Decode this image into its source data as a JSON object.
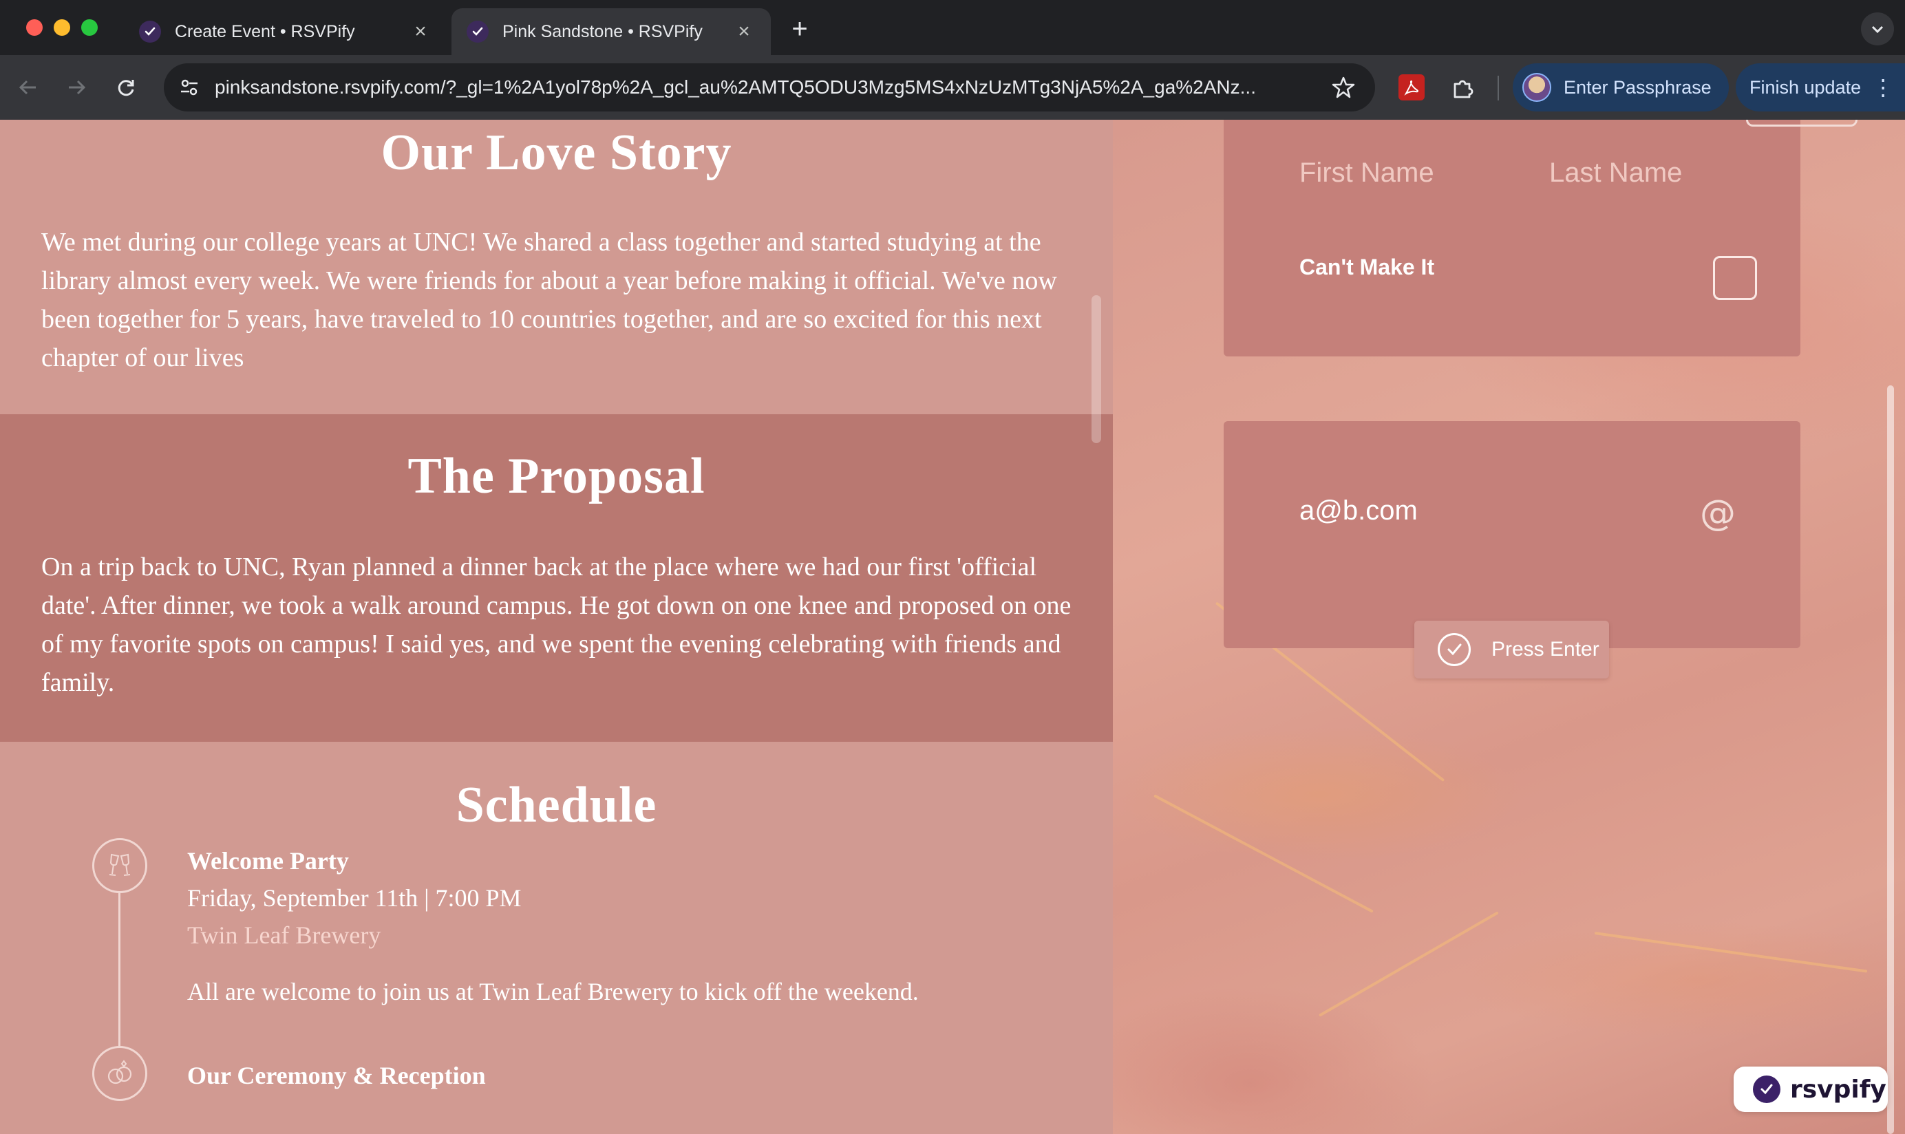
{
  "browser": {
    "tabs": [
      {
        "title": "Create Event • RSVPify",
        "active": false
      },
      {
        "title": "Pink Sandstone • RSVPify",
        "active": true
      }
    ],
    "url": "pinksandstone.rsvpify.com/?_gl=1%2A1yol78p%2A_gcl_au%2AMTQ5ODU3Mzg5MS4xNzUzMTg3NjA5%2A_ga%2ANz...",
    "profile_label": "Enter Passphrase",
    "update_label": "Finish update"
  },
  "love_story": {
    "title": "Our Love Story",
    "body": "We met during our college years at UNC! We shared a class together and started studying at the library almost every week. We were friends for about a year before making it official. We've now been together for 5 years, have traveled to 10 countries together, and are so excited for this next chapter of our lives"
  },
  "proposal": {
    "title": "The Proposal",
    "body": "On a trip back to UNC, Ryan planned a dinner back at the place where we had our first 'official date'. After dinner, we took a walk around campus. He got down on one knee and proposed on one of my favorite spots on campus! I said yes, and we spent the evening celebrating with friends and family."
  },
  "schedule": {
    "title": "Schedule",
    "events": [
      {
        "name": "Welcome Party",
        "when": "Friday, September 11th  |  7:00 PM",
        "venue": "Twin Leaf Brewery",
        "description": "All are welcome to join us at Twin Leaf Brewery to kick off the weekend.",
        "icon": "champagne-glasses-icon"
      },
      {
        "name": "Our Ceremony & Reception",
        "icon": "wedding-rings-icon"
      }
    ]
  },
  "rsvp_form": {
    "first_name_placeholder": "First Name",
    "last_name_placeholder": "Last Name",
    "cant_make_it_label": "Can't Make It",
    "email_value": "a@b.com",
    "email_icon": "@",
    "submit_label": "Press Enter"
  },
  "branding": {
    "badge_label": "rsvpify"
  },
  "colors": {
    "section_light": "#d19a92",
    "section_dark": "#b97871",
    "card": "#c5807a",
    "brand_purple": "#3b2168"
  }
}
